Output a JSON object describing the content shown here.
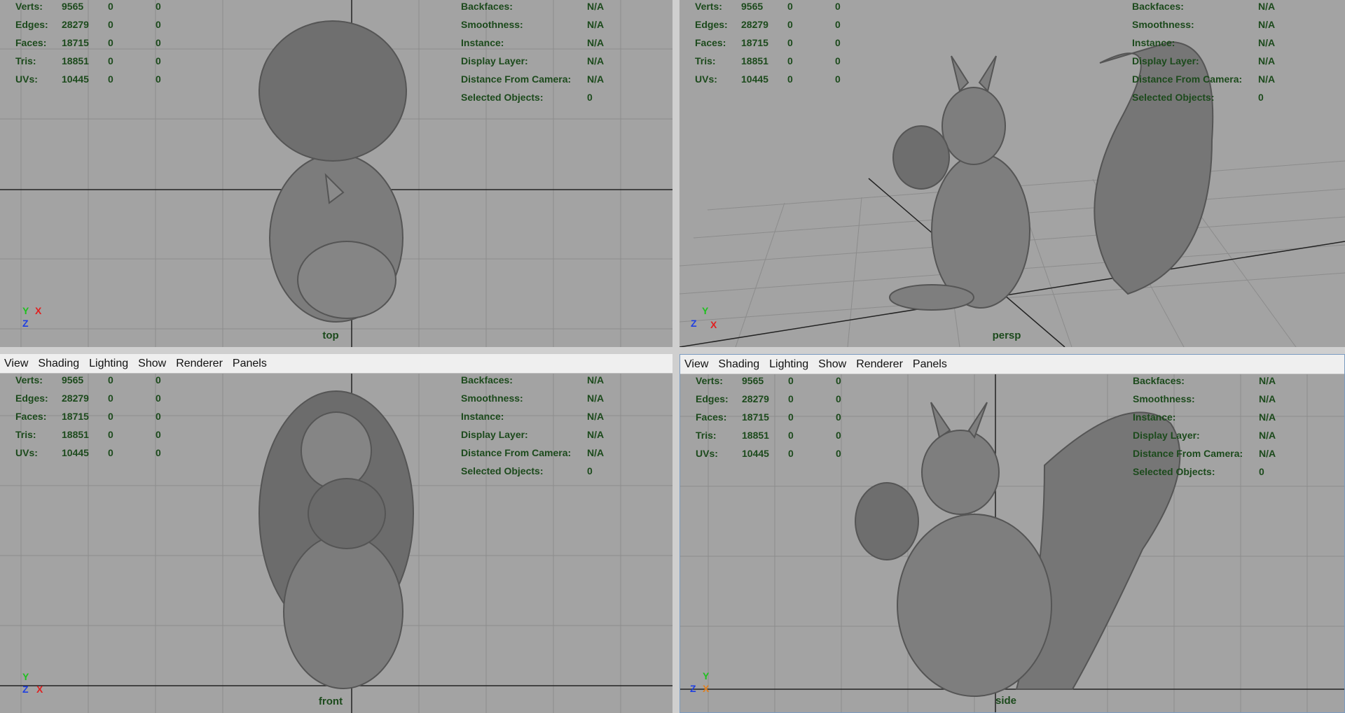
{
  "menus": [
    "View",
    "Shading",
    "Lighting",
    "Show",
    "Renderer",
    "Panels"
  ],
  "hud_left": [
    {
      "label": "Verts:",
      "v1": "9565",
      "v2": "0",
      "v3": "0"
    },
    {
      "label": "Edges:",
      "v1": "28279",
      "v2": "0",
      "v3": "0"
    },
    {
      "label": "Faces:",
      "v1": "18715",
      "v2": "0",
      "v3": "0"
    },
    {
      "label": "Tris:",
      "v1": "18851",
      "v2": "0",
      "v3": "0"
    },
    {
      "label": "UVs:",
      "v1": "10445",
      "v2": "0",
      "v3": "0"
    }
  ],
  "hud_right": [
    {
      "label": "Backfaces:",
      "value": "N/A"
    },
    {
      "label": "Smoothness:",
      "value": "N/A"
    },
    {
      "label": "Instance:",
      "value": "N/A"
    },
    {
      "label": "Display Layer:",
      "value": "N/A"
    },
    {
      "label": "Distance From Camera:",
      "value": "N/A"
    },
    {
      "label": "Selected Objects:",
      "value": "0"
    }
  ],
  "panels": {
    "top": {
      "camera": "top",
      "axis": [
        "Y",
        "X",
        "Z"
      ]
    },
    "persp": {
      "camera": "persp",
      "axis": [
        "Y",
        "Z",
        "X"
      ]
    },
    "front": {
      "camera": "front",
      "axis": [
        "Y",
        "Z",
        "X"
      ]
    },
    "side": {
      "camera": "side",
      "axis": [
        "Y",
        "Z",
        "X"
      ]
    }
  },
  "colors": {
    "viewport_bg": "#a3a3a3",
    "hud_text": "#1c4a1c",
    "axis_x": "#e02020",
    "axis_y": "#20c020",
    "axis_z": "#2040e0"
  }
}
